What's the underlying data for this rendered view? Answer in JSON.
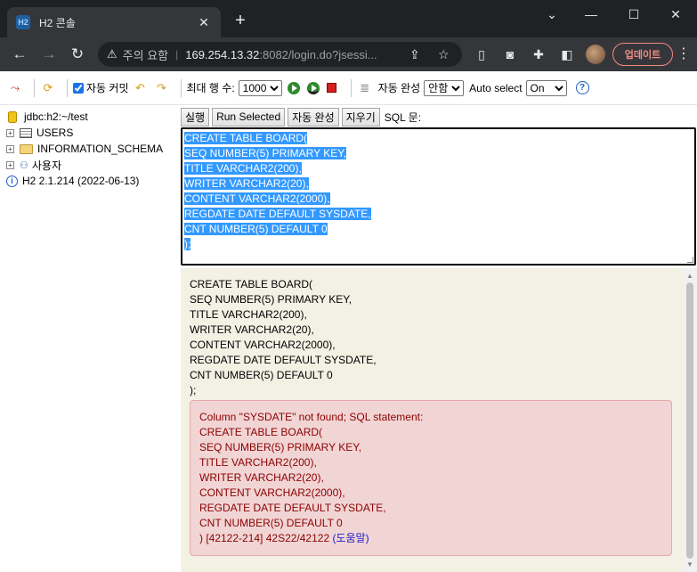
{
  "browser": {
    "tab_title": "H2 콘솔",
    "favicon_text": "H2",
    "security_warning": "주의 요함",
    "url_host": "169.254.13.32",
    "url_rest": ":8082/login.do?jsessi...",
    "update_label": "업데이트"
  },
  "toolbar": {
    "auto_commit_label": "자동 커밋",
    "max_rows_label": "최대 행 수:",
    "max_rows_value": "1000",
    "max_rows_options": [
      "1000"
    ],
    "auto_complete_label": "자동 완성",
    "auto_complete_value": "안함",
    "auto_complete_options": [
      "안함"
    ],
    "auto_select_label": "Auto select",
    "auto_select_value": "On",
    "auto_select_options": [
      "On"
    ]
  },
  "tree": {
    "connection": "jdbc:h2:~/test",
    "items": [
      {
        "label": "USERS"
      },
      {
        "label": "INFORMATION_SCHEMA"
      },
      {
        "label": "사용자"
      }
    ],
    "version": "H2 2.1.214 (2022-06-13)"
  },
  "query_bar": {
    "run_label": "실행",
    "run_selected_label": "Run Selected",
    "auto_complete_label": "자동 완성",
    "clear_label": "지우기",
    "sql_label": "SQL 문:"
  },
  "editor": {
    "lines": [
      "CREATE TABLE BOARD(",
      "SEQ NUMBER(5) PRIMARY KEY,",
      "TITLE VARCHAR2(200),",
      "WRITER VARCHAR2(20),",
      "CONTENT VARCHAR2(2000),",
      "REGDATE DATE DEFAULT SYSDATE,",
      "CNT NUMBER(5) DEFAULT 0",
      ");"
    ]
  },
  "result": {
    "lines": [
      "CREATE TABLE BOARD(",
      "SEQ NUMBER(5) PRIMARY KEY,",
      "TITLE VARCHAR2(200),",
      "WRITER VARCHAR2(20),",
      "CONTENT VARCHAR2(2000),",
      "REGDATE DATE DEFAULT SYSDATE,",
      "CNT NUMBER(5) DEFAULT 0",
      ");"
    ],
    "error_lines": [
      "Column \"SYSDATE\" not found; SQL statement:",
      "CREATE TABLE BOARD(",
      "SEQ NUMBER(5) PRIMARY KEY,",
      "TITLE VARCHAR2(200),",
      "WRITER VARCHAR2(20),",
      "CONTENT VARCHAR2(2000),",
      "REGDATE DATE DEFAULT SYSDATE,",
      "CNT NUMBER(5) DEFAULT 0"
    ],
    "error_code": ") [42122-214] 42S22/42122 ",
    "help_link": "(도움말)"
  },
  "colors": {
    "selection": "#3399ff",
    "error_bg": "#f1d5d5",
    "error_text": "#8b0000",
    "result_bg": "#f3f1e4",
    "update_accent": "#f28b82"
  }
}
